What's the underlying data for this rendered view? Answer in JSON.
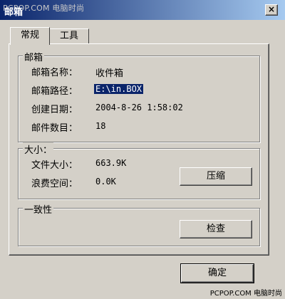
{
  "window": {
    "title": "邮箱",
    "watermark": "PCPOP.COM 电脑时尚",
    "close_glyph": "×"
  },
  "tabs": [
    {
      "label": "常规",
      "active": true
    },
    {
      "label": "工具",
      "active": false
    }
  ],
  "mailbox": {
    "group_label": "邮箱",
    "fields": [
      {
        "label": "邮箱名称：",
        "value": "收件箱"
      },
      {
        "label": "邮箱路径：",
        "value": "E:\\in.BOX"
      },
      {
        "label": "创建日期：",
        "value": "2004-8-26 1:58:02"
      },
      {
        "label": "邮件数目：",
        "value": "18"
      }
    ]
  },
  "size": {
    "group_label": "大小：",
    "fields": [
      {
        "label": "文件大小：",
        "value": "663.9K"
      },
      {
        "label": "浪费空间：",
        "value": "0.0K"
      }
    ],
    "compress_button": "压缩"
  },
  "consistency": {
    "group_label": "一致性",
    "check_button": "检查"
  },
  "footer": {
    "ok_button": "确定",
    "watermark": "PCPOP.COM 电脑时尚"
  }
}
